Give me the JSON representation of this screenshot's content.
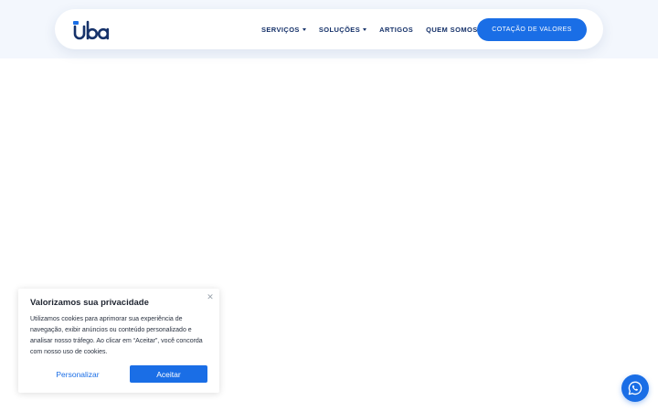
{
  "brand": {
    "name": "uba",
    "accent": "#1a6ee6",
    "dark": "#16326a"
  },
  "nav": {
    "items": [
      {
        "label": "SERVIÇOS",
        "has_dropdown": true
      },
      {
        "label": "SOLUÇÕES",
        "has_dropdown": true
      },
      {
        "label": "ARTIGOS",
        "has_dropdown": false
      },
      {
        "label": "QUEM SOMOS",
        "has_dropdown": false
      }
    ],
    "cta_label": "COTAÇÃO DE VALORES"
  },
  "cookie": {
    "title": "Valorizamos sua privacidade",
    "text": "Utilizamos cookies para aprimorar sua experiência de navegação, exibir anúncios ou conteúdo personalizado e analisar nosso tráfego. Ao clicar em “Aceitar”, você concorda com nosso uso de cookies.",
    "close_icon": "close-icon",
    "customize_label": "Personalizar",
    "accept_label": "Aceitar"
  },
  "floating": {
    "icon": "whatsapp-icon"
  }
}
